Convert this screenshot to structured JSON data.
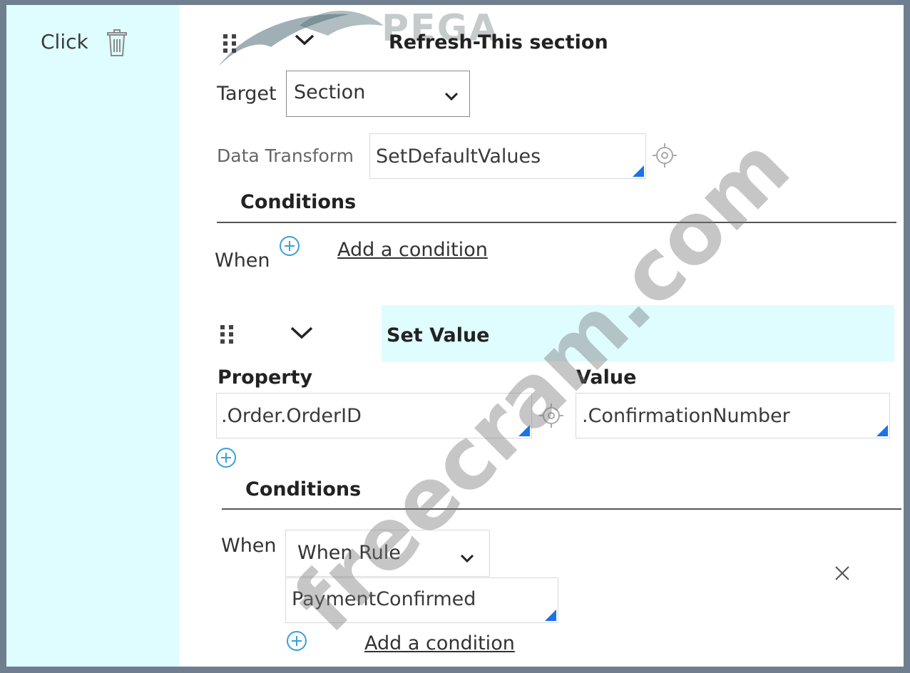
{
  "sidebar": {
    "event_label": "Click"
  },
  "logo": {
    "text": "PEGA"
  },
  "action1": {
    "title": "Refresh-This section",
    "target_label": "Target",
    "target_value": "Section",
    "data_transform_label": "Data Transform",
    "data_transform_value": "SetDefaultValues",
    "conditions_heading": "Conditions",
    "when_label": "When",
    "add_condition_link": "Add a condition"
  },
  "action2": {
    "title": "Set Value",
    "property_label": "Property",
    "value_label": "Value",
    "property_value": ".Order.OrderID",
    "value_value": ".ConfirmationNumber",
    "conditions_heading": "Conditions",
    "when_label": "When",
    "when_type_value": "When Rule",
    "when_rule_value": "PaymentConfirmed",
    "add_condition_link": "Add a condition"
  },
  "watermark": {
    "text": "freecram.com"
  },
  "colors": {
    "highlight": "#dffcff",
    "accent": "#1a73e8",
    "frame": "#6f7f8f"
  }
}
